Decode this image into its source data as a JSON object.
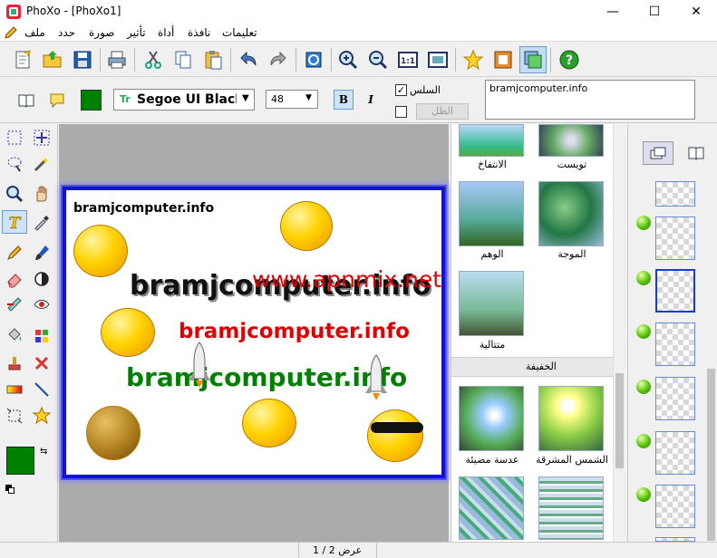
{
  "window": {
    "title": "PhoXo - [PhoXo1]",
    "minimize": "—",
    "maximize": "☐",
    "close": "✕"
  },
  "menu": {
    "items": [
      "ملف",
      "حدد",
      "صورة",
      "تأثير",
      "أداة",
      "نافذة",
      "تعليمات"
    ],
    "mdi_min": "_",
    "mdi_restore": "▫",
    "mdi_close": "×"
  },
  "toolbar": {
    "icons": [
      "new-icon",
      "open-icon",
      "save-icon",
      "print-icon",
      "cut-icon",
      "copy-icon",
      "paste-icon",
      "undo-icon",
      "redo-icon",
      "rotate-icon",
      "zoom-in-icon",
      "zoom-out-icon",
      "actual-size-icon",
      "fit-window-icon",
      "favorite-icon",
      "frame-icon",
      "layer-icon",
      "help-icon"
    ]
  },
  "text_props": {
    "font_name": "Segoe UI Black",
    "font_size": "48",
    "bold": "B",
    "italic": "I",
    "smooth_label": "السلس",
    "smooth_checked": true,
    "shadow_label": "الظل",
    "shadow_checked": false,
    "text_value": "bramjcomputer.info",
    "color": "#008000"
  },
  "canvas": {
    "small_text": "bramjcomputer.info",
    "black_text": "bramjcomputer.info",
    "red_text": "bramjcomputer.info",
    "green_text": "bramjcomputer.info",
    "watermark": "www.apnmix.net",
    "colors": {
      "red": "#e00000",
      "green": "#008000",
      "border": "#1010e0"
    }
  },
  "effects": {
    "row1": [
      "الانتفاخ",
      "تويست"
    ],
    "row2": [
      "الوهم",
      "الموجة"
    ],
    "row3": [
      "متتالية"
    ],
    "section_header": "الخفيفة",
    "row4": [
      "عدسة مضيئة",
      "الشمس المشرقة"
    ]
  },
  "colors": {
    "foreground": "#008000",
    "background": "#ffffff"
  },
  "status": {
    "text": "عرض 2 / 1"
  }
}
